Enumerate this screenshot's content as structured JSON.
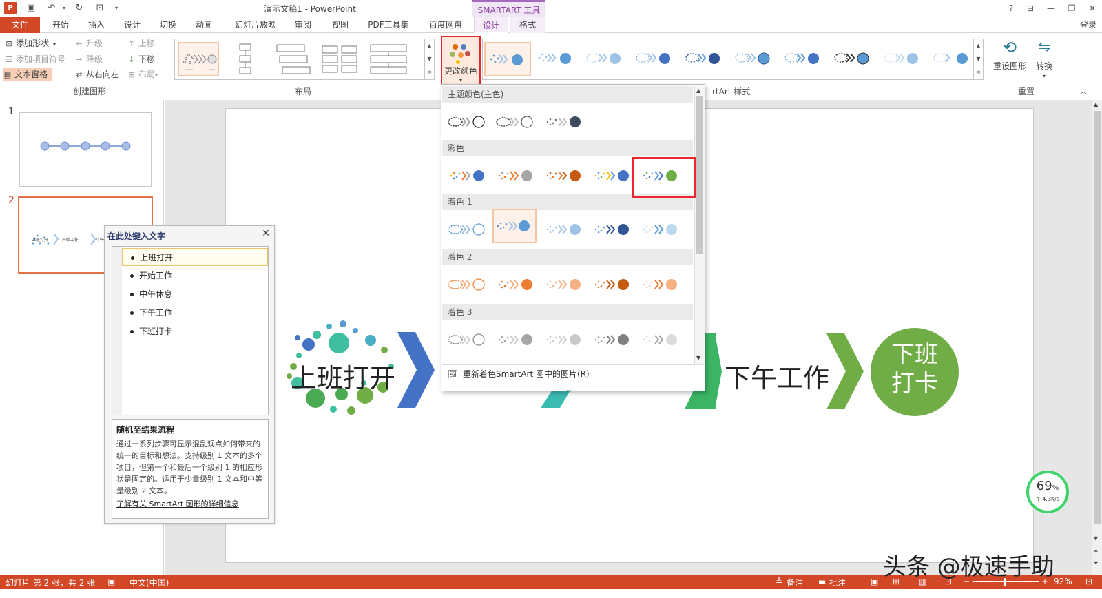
{
  "app": {
    "title": "演示文稿1 - PowerPoint",
    "context_title": "SMARTART 工具",
    "login": "登录"
  },
  "tabs": [
    {
      "label": "文件"
    },
    {
      "label": "开始"
    },
    {
      "label": "插入"
    },
    {
      "label": "设计"
    },
    {
      "label": "切换"
    },
    {
      "label": "动画"
    },
    {
      "label": "幻灯片放映"
    },
    {
      "label": "审阅"
    },
    {
      "label": "视图"
    },
    {
      "label": "PDF工具集"
    },
    {
      "label": "百度网盘"
    },
    {
      "label": "设计"
    },
    {
      "label": "格式"
    }
  ],
  "ribbon": {
    "create_graphic": {
      "add_shape": "添加形状",
      "add_bullet": "添加项目符号",
      "text_pane": "文本窗格",
      "promote": "升级",
      "demote": "降级",
      "right_to_left": "从右向左",
      "move_up": "上移",
      "move_down": "下移",
      "layout": "布局",
      "group_label": "创建图形"
    },
    "layouts_group_label": "布局",
    "change_color": "更改颜色",
    "styles_group_label": "rtArt 样式",
    "reset_graphic": "重设图形",
    "convert": "转换",
    "reset_group_label": "重置"
  },
  "slides": [
    {
      "number": "1"
    },
    {
      "number": "2",
      "thumb_labels": [
        "上班打开",
        "开始工作",
        "中午休息"
      ]
    }
  ],
  "text_pane": {
    "title": "在此处键入文字",
    "items": [
      "上班打开",
      "开始工作",
      "中午休息",
      "下午工作",
      "下班打卡"
    ],
    "desc_title": "随机至结果流程",
    "desc_body": "通过一系列步骤可显示混乱观点如何带来的统一的目标和想法。支持级别 1 文本的多个项目，但第一个和最后一个级别 1 的相应形状是固定的。适用于少量级别 1 文本和中等量级别 2 文本。",
    "desc_link": "了解有关 SmartArt 图形的详细信息"
  },
  "color_dropdown": {
    "sections": [
      {
        "title": "主题颜色(主色)"
      },
      {
        "title": "彩色"
      },
      {
        "title": "着色 1"
      },
      {
        "title": "着色 2"
      },
      {
        "title": "着色 3"
      }
    ],
    "footer": "重新着色SmartArt 图中的图片(R)",
    "colors": {
      "dark": "#3e4a5e",
      "blue": "#4472c4",
      "gray": "#a5a5a5",
      "orange": "#c55a11",
      "gold": "#ffc000",
      "green": "#70ad47",
      "accent1": "#5b9bd5",
      "accent2": "#ed7d31",
      "accent3": "#a5a5a5"
    }
  },
  "slide_content": {
    "step1": "上班打开",
    "step4": "下午工作",
    "step5": "下班\n打卡",
    "step5_line1": "下班",
    "step5_line2": "打卡"
  },
  "status": {
    "slide_info": "幻灯片 第 2 张，共 2 张",
    "language": "中文(中国)",
    "notes": "备注",
    "comments": "批注",
    "zoom": "92%",
    "minus": "−",
    "plus": "+"
  },
  "overlay": {
    "watermark": "头条 @极速手助",
    "speed_percent": "69",
    "speed_unit": "%",
    "speed_rate": "4.3K/s"
  }
}
